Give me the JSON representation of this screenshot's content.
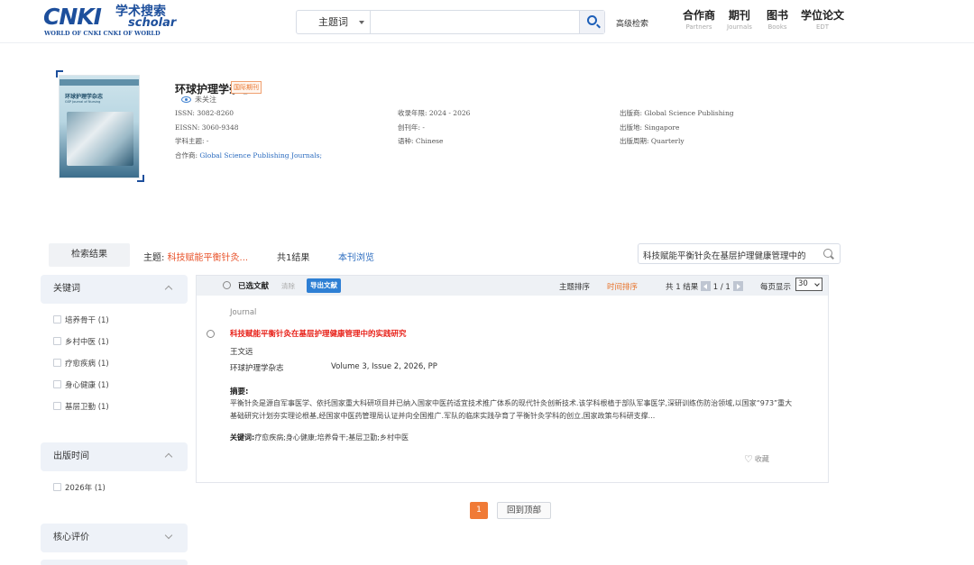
{
  "header": {
    "logo": {
      "main": "CNKI",
      "cn": "学术搜索",
      "en": "scholar",
      "sub": "WORLD OF CNKI CNKI OF WORLD"
    },
    "search": {
      "type": "主题词",
      "value": ""
    },
    "advanced": "高级检索",
    "nav": [
      {
        "title": "合作商",
        "sub": "Partners"
      },
      {
        "title": "期刊",
        "sub": "Journals"
      },
      {
        "title": "图书",
        "sub": "Books"
      },
      {
        "title": "学位论文",
        "sub": "EDT"
      }
    ]
  },
  "journal": {
    "cover": {
      "title": "环球护理学杂志",
      "subtitle": "GSP Journal of Nursing"
    },
    "title": "环球护理学杂志",
    "badge": "国际期刊",
    "follow": "未关注",
    "col1": [
      "ISSN: 3082-8260",
      "EISSN: 3060-9348",
      "学科主题: -",
      "合作商: "
    ],
    "partner": "Global Science Publishing Journals;",
    "col2": [
      "收录年限: 2024 - 2026",
      "创刊年: -",
      "语种: Chinese"
    ],
    "col3": [
      "出版商: Global Science Publishing",
      "出版地: Singapore",
      "出版周期: Quarterly"
    ]
  },
  "results_bar": {
    "tab": "检索结果",
    "topic_label": "主题:",
    "topic_value": "科技赋能平衡针灸...",
    "count": "共1结果",
    "browse": "本刊浏览",
    "inpage_search": "科技赋能平衡针灸在基层护理健康管理中的"
  },
  "sidebar": {
    "keywords": {
      "title": "关键词",
      "items": [
        "培养骨干 (1)",
        "乡村中医 (1)",
        "疗愈疾病 (1)",
        "身心健康 (1)",
        "基层卫勤 (1)"
      ]
    },
    "year": {
      "title": "出版时间",
      "items": [
        "2026年 (1)"
      ]
    },
    "core": {
      "title": "核心评价"
    }
  },
  "toolbar": {
    "selected": "已选文献",
    "clear": "清除",
    "export": "导出文献",
    "sort_topic": "主题排序",
    "sort_time": "时间排序",
    "total_prefix": "共 1 结果",
    "page": "1 / 1",
    "perpage_label": "每页显示",
    "perpage": "30"
  },
  "result": {
    "type": "Journal",
    "title": "科技赋能平衡针灸在基层护理健康管理中的实践研究",
    "author": "王文远",
    "journal": "环球护理学杂志",
    "volume": "Volume 3, Issue 2, 2026, PP",
    "abstract_label": "摘要:",
    "abstract": "平衡针灸是源自军事医学、依托国家重大科研项目并已纳入国家中医药适宜技术推广体系的现代针灸创新技术.该学科根植于部队军事医学,深研训练伤防治领域,以国家“973”重大基础研究计划夯实理论根基,经国家中医药管理局认证并向全国推广.军队的临床实践孕育了平衡针灸学科的创立,国家政策与科研支撑...",
    "keywords_label": "关键词:",
    "keywords": "疗愈疾病;身心健康;培养骨干;基层卫勤;乡村中医",
    "favorite": "收藏"
  },
  "pager": {
    "current": "1",
    "top": "回到顶部"
  },
  "colors": {
    "brand": "#1d4f9c",
    "accent": "#f07a36",
    "link": "#2a6bbf",
    "title_red": "#e8221a"
  }
}
